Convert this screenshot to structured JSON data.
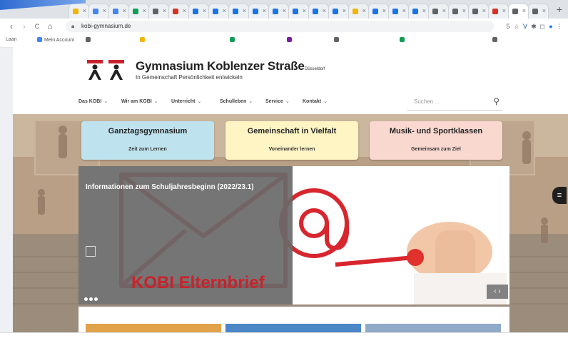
{
  "browser": {
    "tabs": [
      {
        "label": "",
        "color": "#f4b400"
      },
      {
        "label": "",
        "color": "#4285f4"
      },
      {
        "label": "",
        "color": "#4285f4"
      },
      {
        "label": "",
        "color": "#0f9d58"
      },
      {
        "label": "",
        "color": "#5f6368"
      },
      {
        "label": "",
        "color": "#d93025"
      },
      {
        "label": "",
        "color": "#1a73e8"
      },
      {
        "label": "",
        "color": "#1a73e8"
      },
      {
        "label": "",
        "color": "#1a73e8"
      },
      {
        "label": "",
        "color": "#1a73e8"
      },
      {
        "label": "",
        "color": "#1a73e8"
      },
      {
        "label": "",
        "color": "#1a73e8"
      },
      {
        "label": "",
        "color": "#1a73e8"
      },
      {
        "label": "",
        "color": "#1a73e8"
      },
      {
        "label": "",
        "color": "#f4b400"
      },
      {
        "label": "",
        "color": "#1a73e8"
      },
      {
        "label": "",
        "color": "#1a73e8"
      },
      {
        "label": "",
        "color": "#1a73e8"
      },
      {
        "label": "",
        "color": "#5f6368"
      },
      {
        "label": "",
        "color": "#5f6368"
      },
      {
        "label": "",
        "color": "#5f6368"
      },
      {
        "label": "",
        "color": "#d93025"
      },
      {
        "label": "",
        "color": "#5f6368",
        "active": true
      },
      {
        "label": "",
        "color": "#5f6368"
      }
    ],
    "new_tab_symbol": "+",
    "back": "‹",
    "forward": "›",
    "reload": "C",
    "home": "⌂",
    "url": "kobi-gymnasium.de",
    "extensions": [
      {
        "icon": "translate-icon",
        "color": "#5f6368",
        "glyph": "5"
      },
      {
        "icon": "star-icon",
        "color": "#5f6368",
        "glyph": "☆"
      },
      {
        "icon": "v-extension-icon",
        "color": "#1a4fa3",
        "glyph": "V"
      },
      {
        "icon": "puzzle-icon",
        "color": "#5f6368",
        "glyph": "✱"
      },
      {
        "icon": "window-icon",
        "color": "#5f6368",
        "glyph": "◻"
      },
      {
        "icon": "profile-icon",
        "color": "#1a73e8",
        "glyph": "●"
      },
      {
        "icon": "menu-icon",
        "color": "#5f6368",
        "glyph": "⋮"
      }
    ],
    "bookmarks": [
      {
        "label": "Laan",
        "color": ""
      },
      {
        "label": "Mein Account",
        "color": "#4285f4"
      },
      {
        "label": "",
        "color": "#5f6368"
      },
      {
        "label": "",
        "color": "#f4b400"
      },
      {
        "label": "",
        "color": ""
      },
      {
        "label": "",
        "color": "#0f9d58"
      },
      {
        "label": "",
        "color": "#7b1fa2"
      },
      {
        "label": "",
        "color": "#5f6368"
      },
      {
        "label": "",
        "color": "#0f9d58"
      },
      {
        "label": "",
        "color": "#5f6368"
      }
    ]
  },
  "site": {
    "school_name": "Gymnasium Koblenzer Straße",
    "slogan": "In Gemeinschaft Persönlichkeit entwickeln",
    "city": "Düsseldorf",
    "nav": [
      {
        "label": "Das KOBI"
      },
      {
        "label": "Wir am KOBI"
      },
      {
        "label": "Unterricht"
      },
      {
        "label": "Schulleben"
      },
      {
        "label": "Service"
      },
      {
        "label": "Kontakt"
      }
    ],
    "search_placeholder": "Suchen ...",
    "features": [
      {
        "title": "Ganztagsgymnasium",
        "subtitle": "Zeit zum Lernen",
        "color": "#bfe3ee"
      },
      {
        "title": "Gemeinschaft in Vielfalt",
        "subtitle": "Voneinander lernen",
        "color": "#fff5c4"
      },
      {
        "title": "Musik- und Sportklassen",
        "subtitle": "Gemeinsam zum Ziel",
        "color": "#f9d8d0"
      }
    ],
    "slider": {
      "title": "Informationen zum Schuljahresbeginn (2022/23.1)",
      "date": "",
      "body": "",
      "read_more": "",
      "caption": "KOBI Elternbrief",
      "accent": "#d8262e",
      "slides_count": 3
    }
  },
  "download_bar": {
    "item": "",
    "show_all": ""
  }
}
